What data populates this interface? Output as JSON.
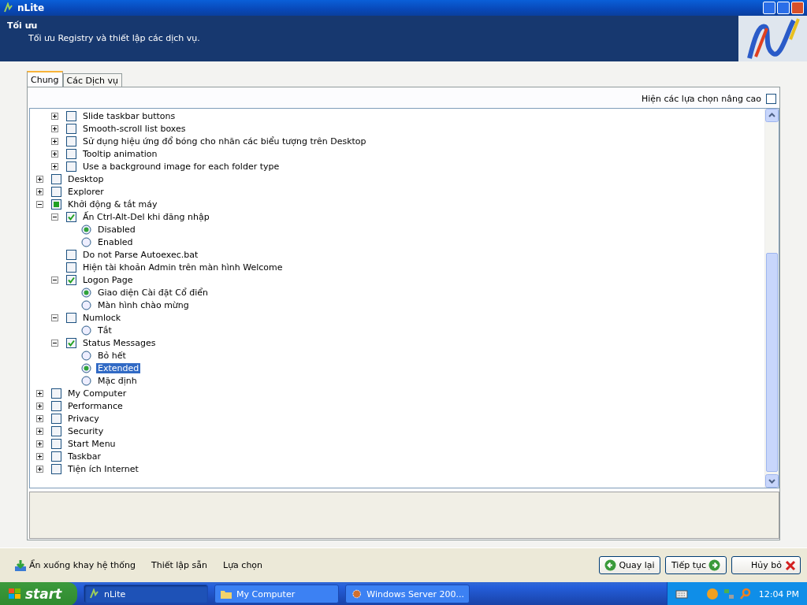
{
  "window": {
    "title": "nLite"
  },
  "header": {
    "title": "Tối ưu",
    "subtitle": "Tối ưu Registry và thiết lập các dịch vụ."
  },
  "tabs": [
    {
      "label": "Chung",
      "selected": true
    },
    {
      "label": "Các Dịch vụ",
      "selected": false
    }
  ],
  "advanced_option": {
    "label": "Hiện các lựa chọn nâng cao",
    "checked": false
  },
  "tree": {
    "clipped_parent_children": [
      {
        "label": "Slide taskbar buttons",
        "kind": "checkbox",
        "checked": false,
        "partial": false,
        "expanded": false
      },
      {
        "label": "Smooth-scroll list boxes",
        "kind": "checkbox",
        "checked": false,
        "partial": false,
        "expanded": false
      },
      {
        "label": "Sử dụng hiệu ứng đổ bóng cho nhãn các biểu tượng trên Desktop",
        "kind": "checkbox",
        "checked": false,
        "partial": false,
        "expanded": false
      },
      {
        "label": "Tooltip animation",
        "kind": "checkbox",
        "checked": false,
        "partial": false,
        "expanded": false
      },
      {
        "label": "Use a background image for each folder type",
        "kind": "checkbox",
        "checked": false,
        "partial": false,
        "expanded": false
      }
    ],
    "items": [
      {
        "label": "Desktop",
        "kind": "checkbox",
        "checked": false,
        "partial": false,
        "expanded": false
      },
      {
        "label": "Explorer",
        "kind": "checkbox",
        "checked": false,
        "partial": false,
        "expanded": false
      },
      {
        "label": "Khởi động & tắt máy",
        "kind": "checkbox",
        "checked": false,
        "partial": true,
        "expanded": true,
        "children": [
          {
            "label": "Ấn Ctrl-Alt-Del khi đăng nhập",
            "kind": "checkbox",
            "checked": true,
            "partial": false,
            "expanded": true,
            "children": [
              {
                "label": "Disabled",
                "kind": "radio",
                "selected": true,
                "highlighted": false
              },
              {
                "label": "Enabled",
                "kind": "radio",
                "selected": false,
                "highlighted": false
              }
            ]
          },
          {
            "label": "Do not Parse Autoexec.bat",
            "kind": "checkbox",
            "checked": false,
            "partial": false
          },
          {
            "label": "Hiện tài khoản Admin trên màn hình Welcome",
            "kind": "checkbox",
            "checked": false,
            "partial": false
          },
          {
            "label": "Logon Page",
            "kind": "checkbox",
            "checked": true,
            "partial": false,
            "expanded": true,
            "children": [
              {
                "label": "Giao diện Cài đặt Cổ điển",
                "kind": "radio",
                "selected": true,
                "highlighted": false
              },
              {
                "label": "Màn hình chào mừng",
                "kind": "radio",
                "selected": false,
                "highlighted": false
              }
            ]
          },
          {
            "label": "Numlock",
            "kind": "checkbox",
            "checked": false,
            "partial": false,
            "expanded": true,
            "children": [
              {
                "label": "Tắt",
                "kind": "radio",
                "selected": false,
                "highlighted": false
              }
            ]
          },
          {
            "label": "Status Messages",
            "kind": "checkbox",
            "checked": true,
            "partial": false,
            "expanded": true,
            "children": [
              {
                "label": "Bỏ hết",
                "kind": "radio",
                "selected": false,
                "highlighted": false
              },
              {
                "label": "Extended",
                "kind": "radio",
                "selected": true,
                "highlighted": true
              },
              {
                "label": "Mặc định",
                "kind": "radio",
                "selected": false,
                "highlighted": false
              }
            ]
          }
        ]
      },
      {
        "label": "My Computer",
        "kind": "checkbox",
        "checked": false,
        "partial": false,
        "expanded": false
      },
      {
        "label": "Performance",
        "kind": "checkbox",
        "checked": false,
        "partial": false,
        "expanded": false
      },
      {
        "label": "Privacy",
        "kind": "checkbox",
        "checked": false,
        "partial": false,
        "expanded": false
      },
      {
        "label": "Security",
        "kind": "checkbox",
        "checked": false,
        "partial": false,
        "expanded": false
      },
      {
        "label": "Start Menu",
        "kind": "checkbox",
        "checked": false,
        "partial": false,
        "expanded": false
      },
      {
        "label": "Taskbar",
        "kind": "checkbox",
        "checked": false,
        "partial": false,
        "expanded": false
      },
      {
        "label": "Tiện ích Internet",
        "kind": "checkbox",
        "checked": false,
        "partial": false,
        "expanded": false
      }
    ]
  },
  "footer": {
    "links": [
      "Ẩn xuống khay hệ thống",
      "Thiết lập sẵn",
      "Lựa chọn"
    ],
    "buttons": [
      {
        "label": "Quay lại",
        "kind": "back"
      },
      {
        "label": "Tiếp tục",
        "kind": "next"
      },
      {
        "label": "Hủy bỏ",
        "kind": "cancel"
      }
    ]
  },
  "taskbar": {
    "start": "start",
    "tasks": [
      {
        "label": "nLite",
        "selected": true,
        "kind": "app"
      },
      {
        "label": "My Computer",
        "selected": false,
        "kind": "folder"
      },
      {
        "label": "Windows Server 200...",
        "selected": false,
        "kind": "setup"
      }
    ],
    "clock": "12:04 PM"
  }
}
